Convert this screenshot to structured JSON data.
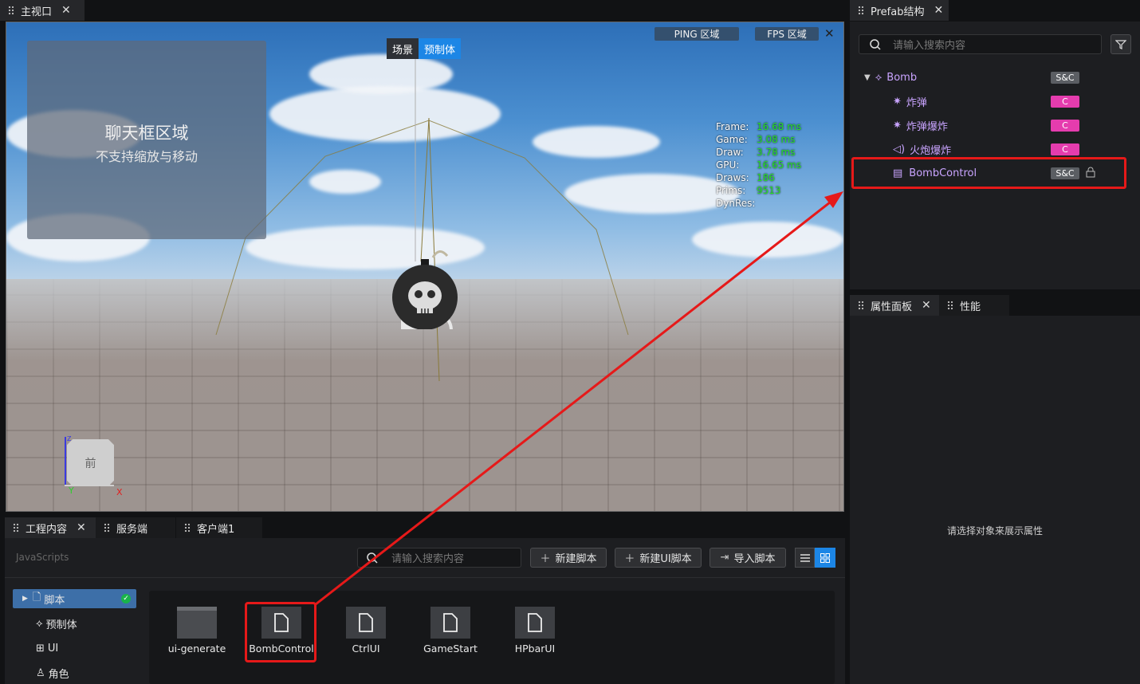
{
  "viewport_tab": {
    "label": "主视口"
  },
  "viewport": {
    "mode_switch": {
      "scene": "场景",
      "prefab": "预制体"
    },
    "ping_label": "PING 区域",
    "fps_label": "FPS 区域",
    "chat": {
      "title": "聊天框区域",
      "subtitle": "不支持缩放与移动"
    },
    "stats": [
      {
        "k": "Frame:",
        "v": "16.68 ms"
      },
      {
        "k": "Game:",
        "v": "3.08 ms"
      },
      {
        "k": "Draw:",
        "v": "3.78 ms"
      },
      {
        "k": "GPU:",
        "v": "16.65 ms"
      },
      {
        "k": "Draws:",
        "v": "186"
      },
      {
        "k": "Prims:",
        "v": "9513"
      },
      {
        "k": "DynRes:",
        "v": ""
      }
    ],
    "gizmo": {
      "face": "前",
      "y_axis": "Y",
      "x_axis": "X",
      "z_axis": "Z"
    }
  },
  "prefab_panel": {
    "tab": "Prefab结构",
    "search_placeholder": "请输入搜索内容",
    "tree": [
      {
        "label": "Bomb",
        "badge": "S&C",
        "icon": "prefab-icon"
      },
      {
        "label": "炸弹",
        "badge": "C",
        "icon": "effect-icon"
      },
      {
        "label": "炸弹爆炸",
        "badge": "C",
        "icon": "effect-icon"
      },
      {
        "label": "火炮爆炸",
        "badge": "C",
        "icon": "sound-icon"
      },
      {
        "label": "BombControl",
        "badge": "S&C",
        "icon": "script-icon"
      }
    ]
  },
  "props_panel": {
    "tab_props": "属性面板",
    "tab_perf": "性能",
    "empty_text": "请选择对象来展示属性"
  },
  "project_panel": {
    "tabs": [
      "工程内容",
      "服务端",
      "客户端1"
    ],
    "section_title": "JavaScripts",
    "search_placeholder": "请输入搜索内容",
    "buttons": {
      "new_script": "新建脚本",
      "new_ui_script": "新建UI脚本",
      "import_script": "导入脚本"
    },
    "sidebar": [
      {
        "label": "脚本",
        "icon": "file-icon"
      },
      {
        "label": "预制体",
        "icon": "prefab-icon"
      },
      {
        "label": "UI",
        "icon": "ui-icon"
      },
      {
        "label": "角色",
        "icon": "character-icon"
      }
    ],
    "files": [
      {
        "label": "ui-generate",
        "icon": "folder-icon"
      },
      {
        "label": "BombControl",
        "icon": "script-file-icon"
      },
      {
        "label": "CtrlUI",
        "icon": "script-file-icon"
      },
      {
        "label": "GameStart",
        "icon": "script-file-icon"
      },
      {
        "label": "HPbarUI",
        "icon": "script-file-icon"
      }
    ]
  },
  "colors": {
    "accent": "#1c86e6",
    "highlight": "#e61919",
    "badge_c": "#e53cae",
    "stat_value": "#28e028"
  }
}
